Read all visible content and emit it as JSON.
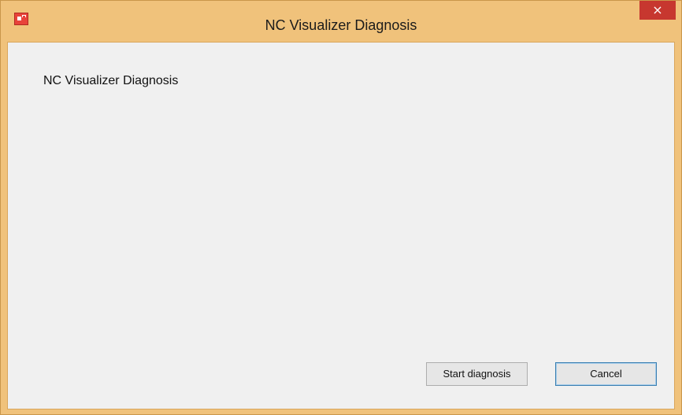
{
  "window": {
    "title": "NC Visualizer Diagnosis",
    "close_label": "×"
  },
  "main": {
    "heading": "NC Visualizer Diagnosis"
  },
  "buttons": {
    "start_label": "Start diagnosis",
    "cancel_label": "Cancel"
  },
  "icons": {
    "app": "app-icon",
    "close": "close-icon"
  },
  "colors": {
    "frame": "#f0c27b",
    "close": "#c7372f",
    "client": "#f0f0f0",
    "default_button_border": "#3c7fb1"
  }
}
